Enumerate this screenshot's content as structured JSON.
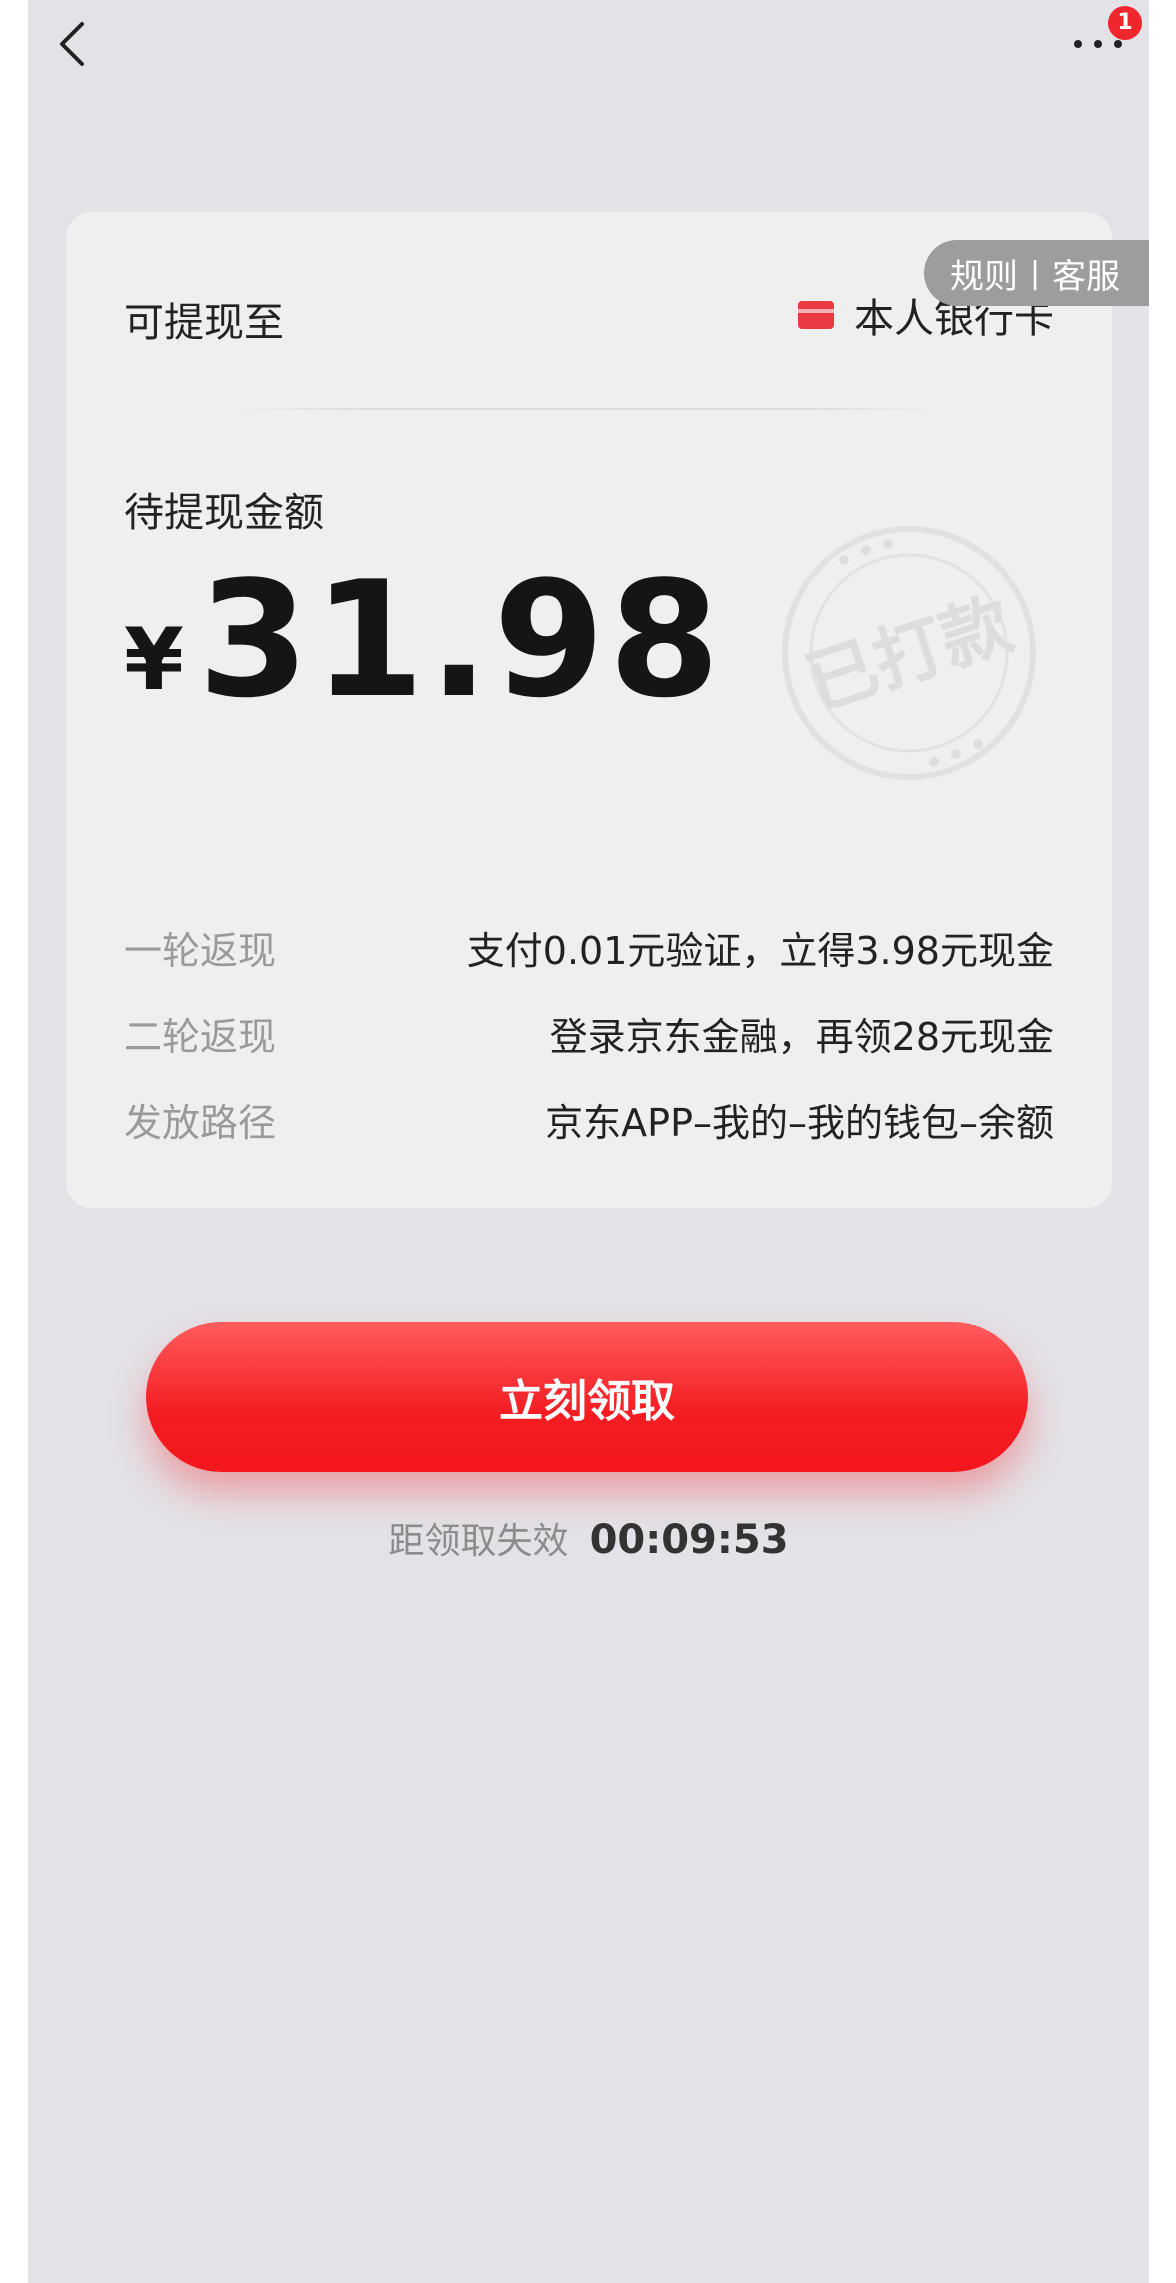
{
  "header": {
    "back_label": "",
    "more_badge": "1"
  },
  "top_links": {
    "rules": "规则",
    "separator": "|",
    "service": "客服"
  },
  "card": {
    "withdraw_to_label": "可提现至",
    "bank_card_text": "本人银行卡",
    "pending_label": "待提现金额",
    "currency": "¥",
    "amount": "31.98",
    "stamp_text": "已打款",
    "info_rows": [
      {
        "label": "一轮返现",
        "value": "支付0.01元验证，立得3.98元现金"
      },
      {
        "label": "二轮返现",
        "value": "登录京东金融，再领28元现金"
      },
      {
        "label": "发放路径",
        "value": "京东APP–我的–我的钱包–余额"
      }
    ]
  },
  "claim_button": {
    "label": "立刻领取"
  },
  "countdown": {
    "label": "距领取失效",
    "time": "00:09:53"
  },
  "colors": {
    "background": "#e3e2e7",
    "card": "#efeff0",
    "accent_red": "#f41d22",
    "badge_red": "#f0262d",
    "muted_text": "#9a9a9c"
  },
  "icons": {
    "back": "chevron-left-icon",
    "more": "ellipsis-icon",
    "bank": "bank-card-icon",
    "stamp": "paid-stamp-icon"
  }
}
